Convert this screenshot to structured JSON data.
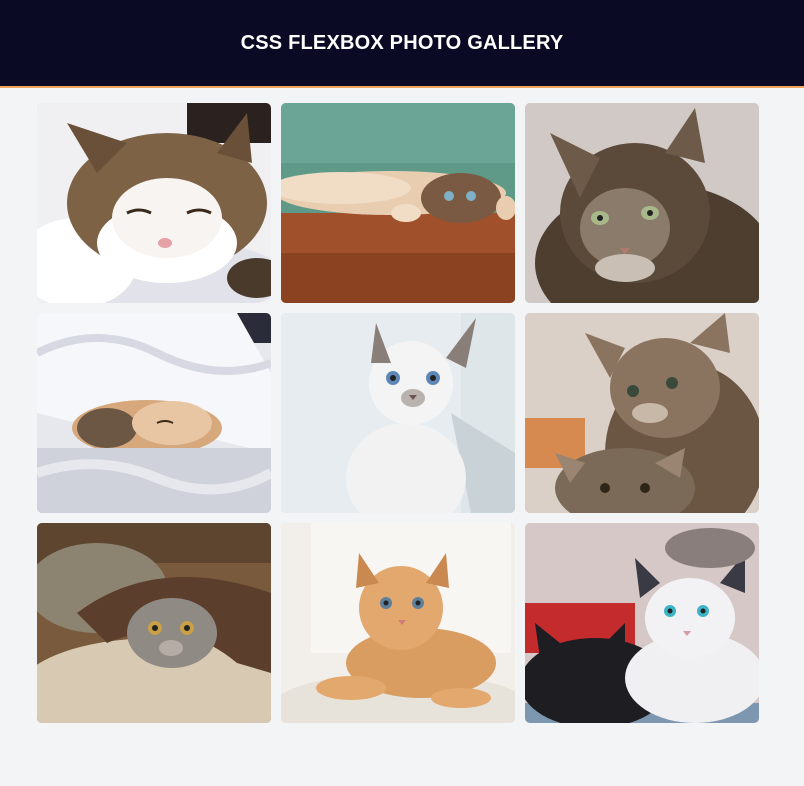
{
  "header": {
    "title": "CSS FLEXBOX PHOTO GALLERY"
  },
  "colors": {
    "header_bg": "#0a0a24",
    "header_border": "#f0a35a",
    "page_bg": "#f3f4f6"
  },
  "gallery": {
    "photos": [
      {
        "name": "sleeping-tabby-white-cat",
        "palette": [
          "#e9e9ee",
          "#8a6a45",
          "#ffffff",
          "#3a2a1a"
        ]
      },
      {
        "name": "kitten-lying-on-wood-floor",
        "palette": [
          "#5f9a88",
          "#a0502a",
          "#e8c6a6",
          "#4a3220"
        ]
      },
      {
        "name": "long-haired-tabby-cat",
        "palette": [
          "#cfc8c4",
          "#4e3e30",
          "#8b7b6a",
          "#2e241c"
        ]
      },
      {
        "name": "kitten-under-white-blanket",
        "palette": [
          "#e6e8ee",
          "#c3c6cf",
          "#d8a67a",
          "#6c5644"
        ]
      },
      {
        "name": "white-siamese-kitten",
        "palette": [
          "#e5ebee",
          "#f3f3f3",
          "#b9b2ae",
          "#5e86b6"
        ]
      },
      {
        "name": "two-tabby-kittens",
        "palette": [
          "#d9cec7",
          "#6b5644",
          "#9a8572",
          "#3a2e24"
        ]
      },
      {
        "name": "grey-kitten-under-rug",
        "palette": [
          "#7a5a3c",
          "#d8c9b2",
          "#5b4b3d",
          "#8c8470"
        ]
      },
      {
        "name": "orange-kitten-lying",
        "palette": [
          "#f1eee8",
          "#d99d62",
          "#ffffff",
          "#8a5a32"
        ]
      },
      {
        "name": "black-and-white-kittens",
        "palette": [
          "#d5c7c6",
          "#1d1d22",
          "#f0f0f2",
          "#c32b2d"
        ]
      }
    ]
  }
}
